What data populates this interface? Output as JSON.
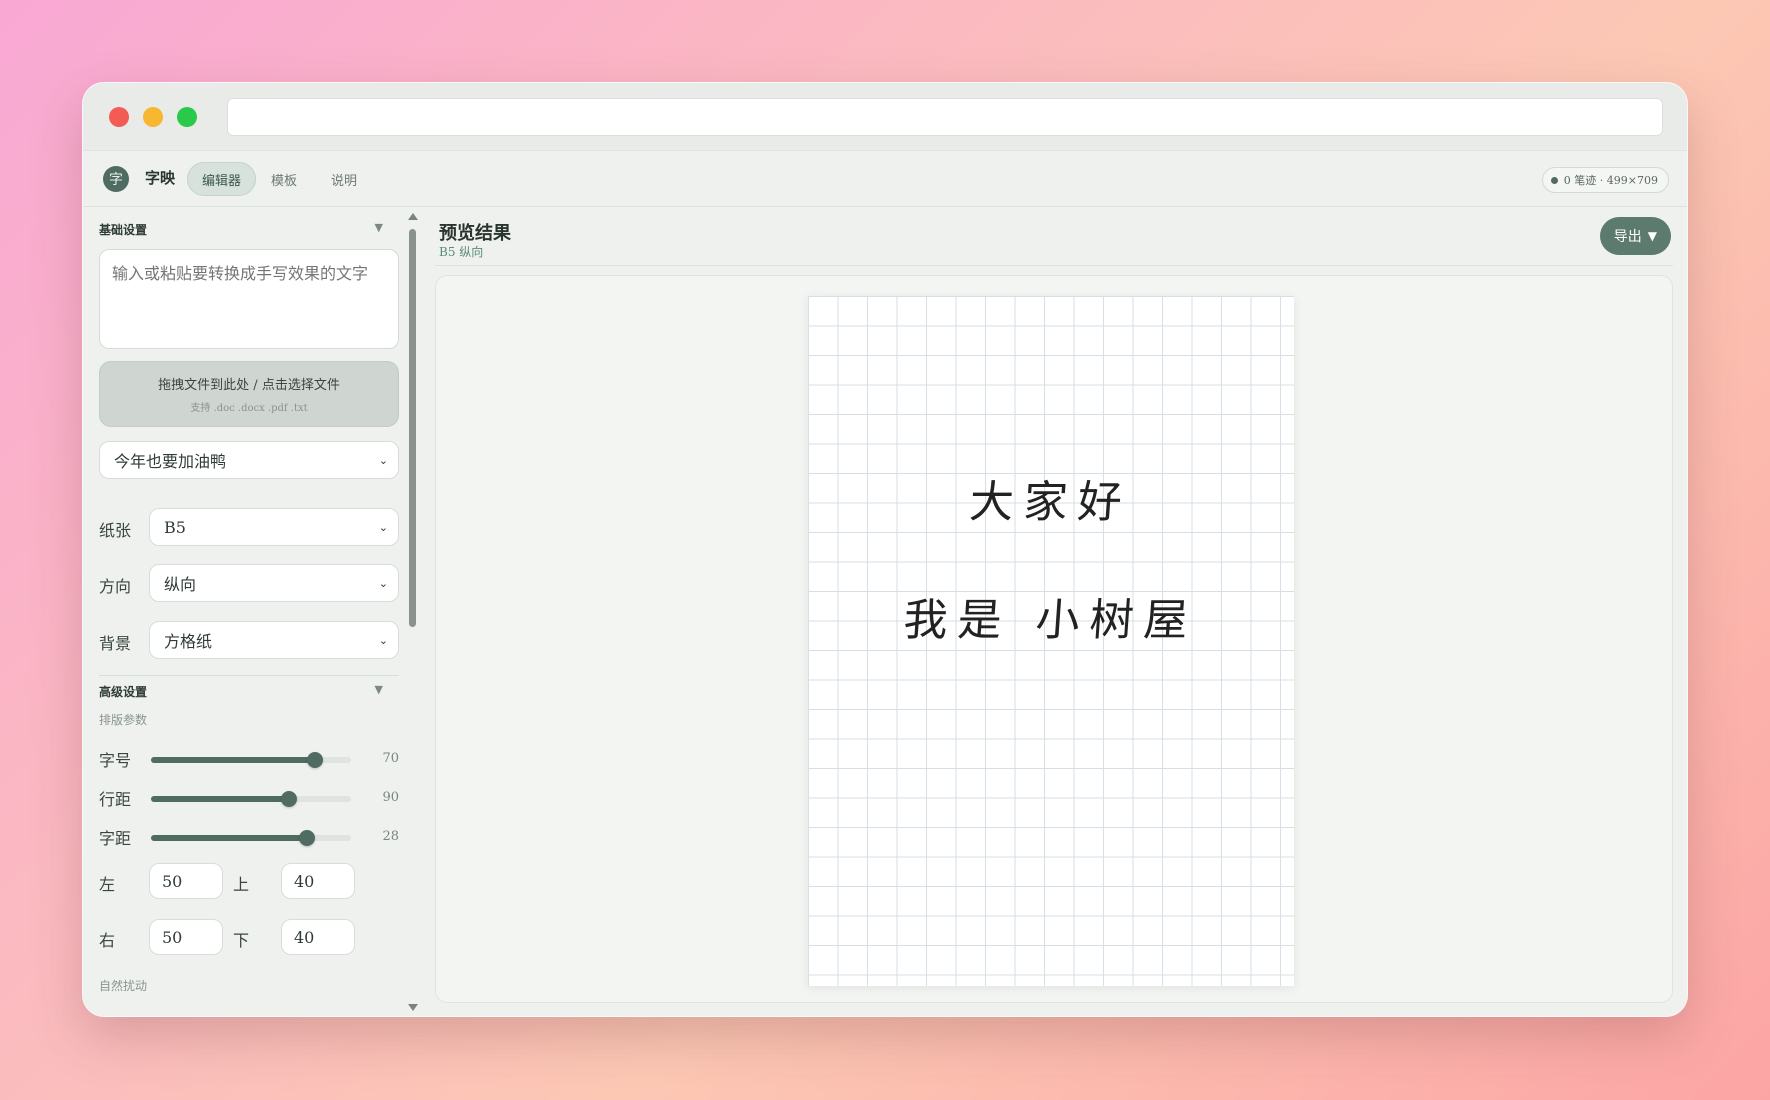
{
  "app": {
    "name": "字映",
    "logo_glyph": "字",
    "tabs": [
      {
        "label": "编辑器",
        "active": true
      },
      {
        "label": "模板",
        "active": false
      },
      {
        "label": "说明",
        "active": false
      }
    ],
    "status": "0 笔迹 · 499×709"
  },
  "sidebar": {
    "basic_title": "基础设置",
    "text_placeholder": "输入或粘贴要转换成手写效果的文字",
    "dropzone_main": "拖拽文件到此处 / 点击选择文件",
    "dropzone_sub": "支持 .doc .docx .pdf .txt",
    "font_select": "今年也要加油鸭",
    "paper_label": "纸张",
    "paper_value": "B5",
    "orientation_label": "方向",
    "orientation_value": "纵向",
    "background_label": "背景",
    "background_value": "方格纸",
    "advanced_title": "高级设置",
    "layout_params": "排版参数",
    "sliders": [
      {
        "label": "字号",
        "value": "70",
        "fraction": 0.82
      },
      {
        "label": "行距",
        "value": "90",
        "fraction": 0.69
      },
      {
        "label": "字距",
        "value": "28",
        "fraction": 0.78
      }
    ],
    "margins": {
      "left_label": "左",
      "left_value": "50",
      "top_label": "上",
      "top_value": "40",
      "right_label": "右",
      "right_value": "50",
      "bottom_label": "下",
      "bottom_value": "40"
    },
    "natural_jitter": "自然扰动"
  },
  "main": {
    "title": "预览结果",
    "subtitle": "B5 纵向",
    "export_label": "导出",
    "export_caret": "▼",
    "lines": [
      "大家好",
      "我是 小树屋"
    ]
  },
  "colors": {
    "accent": "#4f6b62",
    "export_bg": "#5d7a6f",
    "grid_line": "#d6dfe6"
  }
}
